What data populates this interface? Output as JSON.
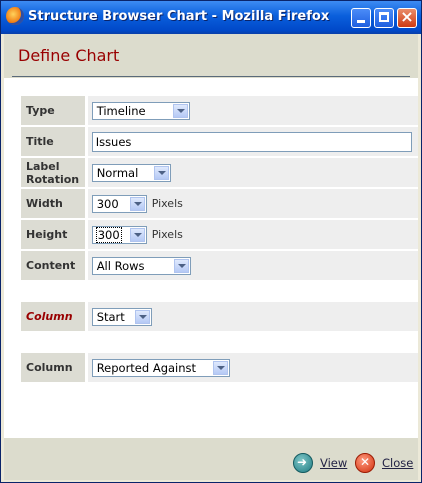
{
  "window": {
    "title": "Structure Browser Chart - Mozilla Firefox"
  },
  "header": {
    "title": "Define Chart"
  },
  "form": {
    "type": {
      "label": "Type",
      "value": "Timeline"
    },
    "title": {
      "label": "Title",
      "value": "Issues"
    },
    "label_rotation": {
      "label_line1": "Label",
      "label_line2": "Rotation",
      "value": "Normal"
    },
    "width": {
      "label": "Width",
      "value": "300",
      "unit": "Pixels"
    },
    "height": {
      "label": "Height",
      "value": "300",
      "unit": "Pixels"
    },
    "content": {
      "label": "Content",
      "value": "All Rows"
    },
    "column_italic": {
      "label": "Column",
      "value": "Start"
    },
    "column": {
      "label": "Column",
      "value": "Reported Against"
    }
  },
  "footer": {
    "view_label": "View",
    "close_label": "Close"
  },
  "colors": {
    "accent": "#990000",
    "header_bg": "#dcdccd",
    "titlebar": "#0a5fdc"
  }
}
